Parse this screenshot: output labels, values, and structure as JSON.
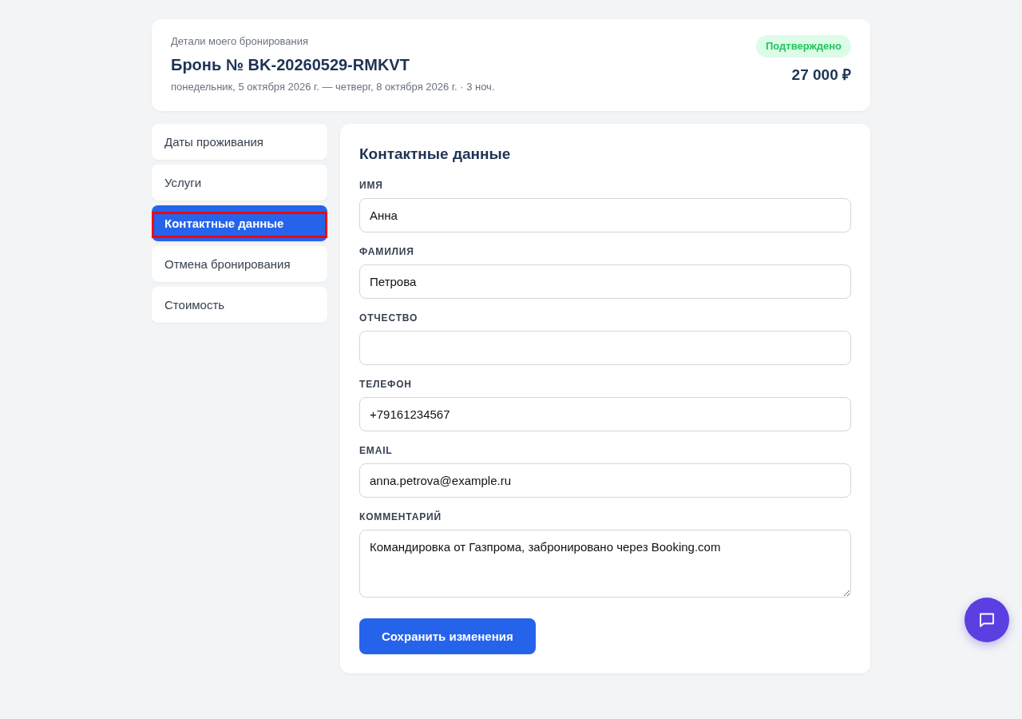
{
  "header": {
    "caption": "Детали моего бронирования",
    "title": "Бронь № BK-20260529-RMKVT",
    "dates": "понедельник, 5 октября 2026 г. — четверг, 8 октября 2026 г. · 3 ноч.",
    "status": {
      "label": "Подтверждено",
      "kind": "confirmed"
    },
    "total": "27 000 ₽"
  },
  "sidebar": {
    "items": [
      {
        "label": "Даты проживания",
        "selected": false,
        "highlighted": false
      },
      {
        "label": "Услуги",
        "selected": false,
        "highlighted": false
      },
      {
        "label": "Контактные данные",
        "selected": true,
        "highlighted": true
      },
      {
        "label": "Отмена бронирования",
        "selected": false,
        "highlighted": false
      },
      {
        "label": "Стоимость",
        "selected": false,
        "highlighted": false
      }
    ]
  },
  "form": {
    "title": "Контактные данные",
    "fields": [
      {
        "kind": "input",
        "label": "ИМЯ",
        "value": "Анна"
      },
      {
        "kind": "input",
        "label": "ФАМИЛИЯ",
        "value": "Петрова"
      },
      {
        "kind": "input",
        "label": "ОТЧЕСТВО"
      },
      {
        "kind": "input",
        "label": "ТЕЛЕФОН",
        "value": "+79161234567"
      },
      {
        "kind": "input",
        "label": "EMAIL",
        "value": "anna.petrova@example.ru"
      },
      {
        "kind": "textarea",
        "label": "КОММЕНТАРИЙ",
        "value": "Командировка от Газпрома, забронировано через Booking.com"
      }
    ],
    "submit": "Сохранить изменения"
  }
}
